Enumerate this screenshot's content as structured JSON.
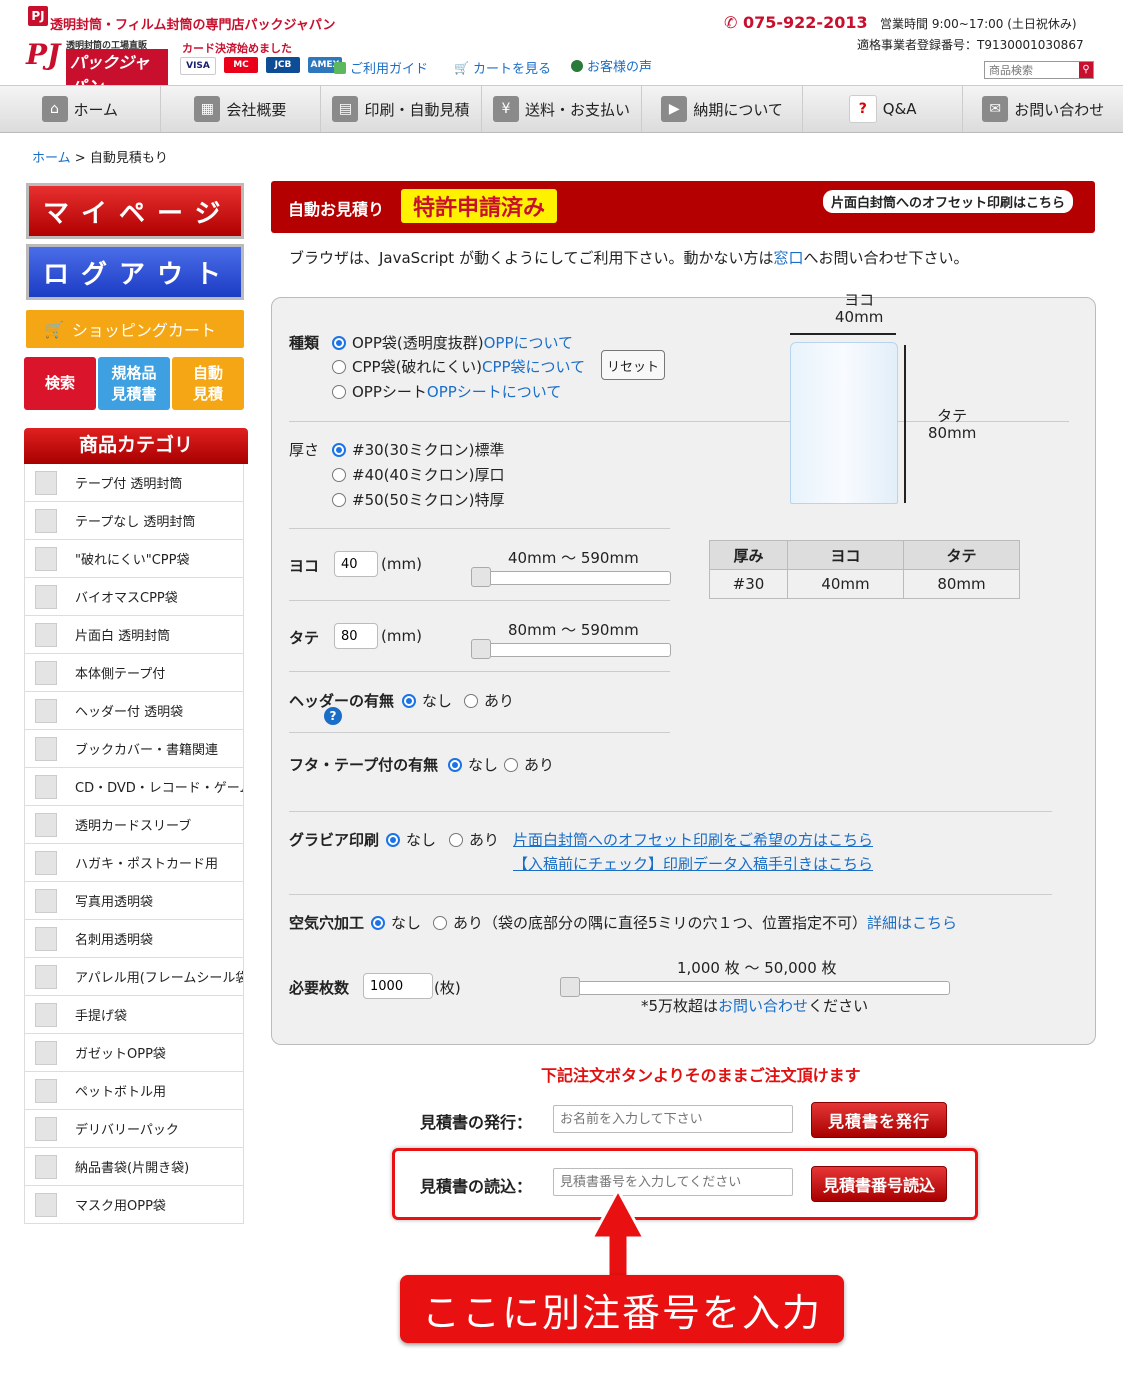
{
  "header": {
    "logo_mark": "PJ",
    "site_title": "透明封筒・フィルム封筒の専門店パックジャパン",
    "logo_pj": "PJ",
    "logo_sub": "透明封筒の工場直販",
    "logo_name": "パックジャパン",
    "card_text": "カード決済始めました",
    "cards": [
      "VISA",
      "MC",
      "JCB",
      "AMEX"
    ],
    "guide_link": "ご利用ガイド",
    "cart_link": "カートを見る",
    "voice_link": "お客様の声",
    "phone": "075-922-2013",
    "hours": "営業時間 9:00~17:00 (土日祝休み)",
    "reg_no": "適格事業者登録番号：T9130001030867",
    "search_placeholder": "商品検索"
  },
  "nav": [
    {
      "label": "ホーム",
      "icon": "home-icon"
    },
    {
      "label": "会社概要",
      "icon": "building-icon"
    },
    {
      "label": "印刷・自動見積",
      "icon": "print-icon"
    },
    {
      "label": "送料・お支払い",
      "icon": "yen-icon"
    },
    {
      "label": "納期について",
      "icon": "truck-icon"
    },
    {
      "label": "Q&A",
      "icon": "question-icon"
    },
    {
      "label": "お問い合わせ",
      "icon": "mail-icon"
    }
  ],
  "breadcrumb": {
    "home": "ホーム",
    "sep": ">",
    "current": "自動見積もり"
  },
  "sidebar": {
    "mypage": "マイページ",
    "logout": "ログアウト",
    "cart": "ショッピングカート",
    "mini": [
      {
        "label": "検索",
        "color": "#d9142b"
      },
      {
        "label": "規格品\n見積書",
        "color": "#3ea0e0"
      },
      {
        "label": "自動\n見積",
        "color": "#f5a614"
      }
    ],
    "cat_head": "商品カテゴリ",
    "categories": [
      "テープ付 透明封筒",
      "テープなし 透明封筒",
      "\"破れにくい\"CPP袋",
      "バイオマスCPP袋",
      "片面白 透明封筒",
      "本体側テープ付",
      "ヘッダー付 透明袋",
      "ブックカバー・書籍関連",
      "CD・DVD・レコード・ゲーム",
      "透明カードスリーブ",
      "ハガキ・ポストカード用",
      "写真用透明袋",
      "名刺用透明袋",
      "アパレル用(フレームシール袋)",
      "手提げ袋",
      "ガゼットOPP袋",
      "ペットボトル用",
      "デリバリーパック",
      "納品書袋(片開き袋)",
      "マスク用OPP袋"
    ]
  },
  "main": {
    "title": "自動お見積り",
    "patent": "特許申請済み",
    "offset_btn": "片面白封筒へのオフセット印刷はこちら",
    "js_note_a": "ブラウザは、JavaScript が動くようにしてご利用下さい。動かない方は",
    "js_note_link": "窓口",
    "js_note_b": "へお問い合わせ下さい。"
  },
  "form": {
    "type_label": "種類",
    "types": [
      {
        "label": "OPP袋(透明度抜群)",
        "link": "OPPについて",
        "selected": true
      },
      {
        "label": "CPP袋(破れにくい)",
        "link": "CPP袋について",
        "selected": false
      },
      {
        "label": "OPPシート",
        "link": "OPPシートについて",
        "selected": false
      }
    ],
    "reset": "リセット",
    "thick_label": "厚さ",
    "thicks": [
      {
        "label": "#30(30ミクロン)標準",
        "selected": true
      },
      {
        "label": "#40(40ミクロン)厚口",
        "selected": false
      },
      {
        "label": "#50(50ミクロン)特厚",
        "selected": false
      }
    ],
    "width_label": "ヨコ",
    "width_value": "40",
    "width_unit": "(mm)",
    "width_range": "40mm ～ 590mm",
    "height_label": "タテ",
    "height_value": "80",
    "height_unit": "(mm)",
    "height_range": "80mm ～ 590mm",
    "header_label": "ヘッダーの有無",
    "header_help": "?",
    "flap_label": "フタ・テープ付の有無",
    "none": "なし",
    "yes": "あり",
    "gravure_label": "グラビア印刷",
    "gravure_link1": "片面白封筒へのオフセット印刷をご希望の方はこちら",
    "gravure_link2": "【入稿前にチェック】印刷データ入稿手引きはこちら",
    "air_label": "空気穴加工",
    "air_note": "（袋の底部分の隅に直径5ミリの穴１つ、位置指定不可）",
    "air_link": "詳細はこちら",
    "qty_label": "必要枚数",
    "qty_value": "1000",
    "qty_unit": "(枚)",
    "qty_range": "1,000 枚 ～ 50,000 枚",
    "qty_note_a": "*5万枚超は",
    "qty_note_link": "お問い合わせ",
    "qty_note_b": "ください"
  },
  "preview": {
    "w_label": "ヨコ",
    "w_value": "40mm",
    "h_label": "タテ",
    "h_value": "80mm",
    "table_headers": [
      "厚み",
      "ヨコ",
      "タテ"
    ],
    "table_row": [
      "#30",
      "40mm",
      "80mm"
    ]
  },
  "bottom": {
    "order_note": "下記注文ボタンよりそのままご注文頂けます",
    "issue_label": "見積書の発行：",
    "issue_placeholder": "お名前を入力して下さい",
    "issue_btn": "見積書を発行",
    "read_label": "見積書の読込：",
    "read_placeholder": "見積書番号を入力してください",
    "read_btn": "見積書番号読込",
    "callout": "ここに別注番号を入力",
    "accent": "#e81010"
  }
}
